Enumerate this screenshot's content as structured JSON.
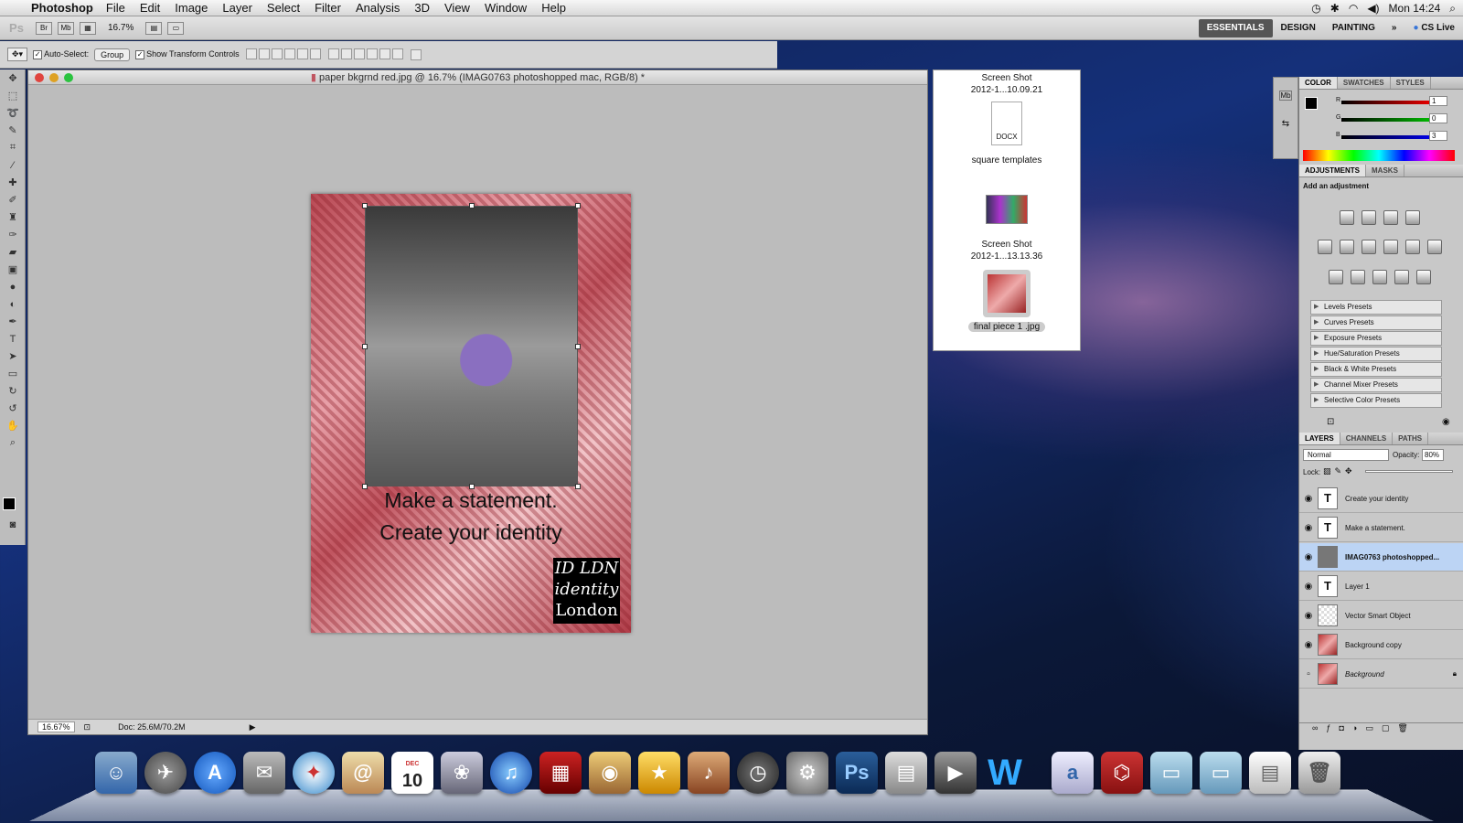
{
  "menubar": {
    "app_name": "Photoshop",
    "items": [
      "File",
      "Edit",
      "Image",
      "Layer",
      "Select",
      "Filter",
      "Analysis",
      "3D",
      "View",
      "Window",
      "Help"
    ],
    "clock": "Mon 14:24"
  },
  "options": {
    "ps_logo": "Ps",
    "zoom": "16.7%",
    "workspaces": [
      "ESSENTIALS",
      "DESIGN",
      "PAINTING"
    ],
    "more": "»",
    "cs_live": "CS Live"
  },
  "tool_options": {
    "auto_select_label": "Auto-Select:",
    "auto_select_value": "Group",
    "transform_label": "Show Transform Controls"
  },
  "document": {
    "title": "paper bkgrnd red.jpg @ 16.7% (IMAG0763 photoshopped mac, RGB/8) *",
    "zoom_status": "16.67%",
    "doc_size": "Doc: 25.6M/70.2M",
    "tagline1": "Make a statement.",
    "tagline2": "Create your identity",
    "logo_line1": "ID LDN",
    "logo_line2": "identity",
    "logo_line3": "London"
  },
  "finder": {
    "item1_line1": "Screen Shot",
    "item1_line2": "2012-1...10.09.21",
    "docx": "DOCX",
    "item2": "square templates",
    "item3_line1": "Screen Shot",
    "item3_line2": "2012-1...13.13.36",
    "item4": "final piece 1 .jpg"
  },
  "panels": {
    "color_tabs": [
      "COLOR",
      "SWATCHES",
      "STYLES"
    ],
    "r_label": "R",
    "g_label": "G",
    "b_label": "B",
    "r_value": "1",
    "g_value": "0",
    "b_value": "3",
    "adj_tabs": [
      "ADJUSTMENTS",
      "MASKS"
    ],
    "adj_heading": "Add an adjustment",
    "presets": [
      "Levels Presets",
      "Curves Presets",
      "Exposure Presets",
      "Hue/Saturation Presets",
      "Black & White Presets",
      "Channel Mixer Presets",
      "Selective Color Presets"
    ],
    "layer_tabs": [
      "LAYERS",
      "CHANNELS",
      "PATHS"
    ],
    "blend_mode": "Normal",
    "opacity_label": "Opacity:",
    "opacity_value": "80%",
    "lock_label": "Lock:",
    "layers": [
      {
        "name": "Create your identity",
        "thumb": "T"
      },
      {
        "name": "Make a statement.",
        "thumb": "T"
      },
      {
        "name": "IMAG0763 photoshopped...",
        "thumb": ""
      },
      {
        "name": "Layer 1",
        "thumb": "T"
      },
      {
        "name": "Vector Smart Object",
        "thumb": ""
      },
      {
        "name": "Background copy",
        "thumb": ""
      },
      {
        "name": "Background",
        "thumb": ""
      }
    ]
  },
  "dock": {
    "ps_label": "Ps",
    "calendar_day": "10",
    "calendar_month": "DEC",
    "word_label": "W"
  },
  "colors": {
    "accent": "#3875d7",
    "selected_layer": "#bcd4f4",
    "artboard_red": "#c05560"
  }
}
